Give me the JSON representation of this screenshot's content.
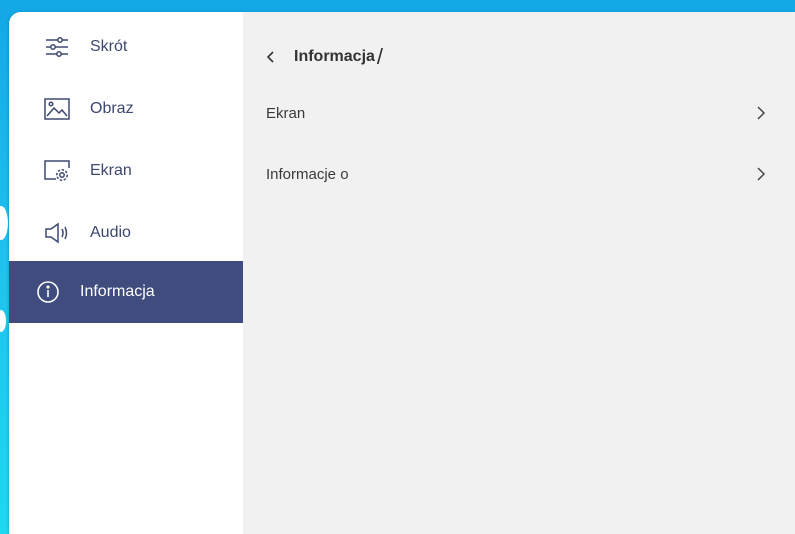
{
  "sidebar": {
    "items": [
      {
        "label": "Skrót",
        "icon": "sliders-icon",
        "active": false
      },
      {
        "label": "Obraz",
        "icon": "image-icon",
        "active": false
      },
      {
        "label": "Ekran",
        "icon": "screen-settings-icon",
        "active": false
      },
      {
        "label": "Audio",
        "icon": "speaker-icon",
        "active": false
      },
      {
        "label": "Informacja",
        "icon": "info-icon",
        "active": true
      }
    ]
  },
  "header": {
    "title": "Informacja",
    "separator": "/"
  },
  "main": {
    "rows": [
      {
        "label": "Ekran"
      },
      {
        "label": "Informacje o"
      }
    ]
  },
  "colors": {
    "active_bg": "#3f4c7d",
    "content_bg": "#f1f1f1",
    "sidebar_text": "#3d4870",
    "desktop_bg": "#1fc0ee"
  }
}
